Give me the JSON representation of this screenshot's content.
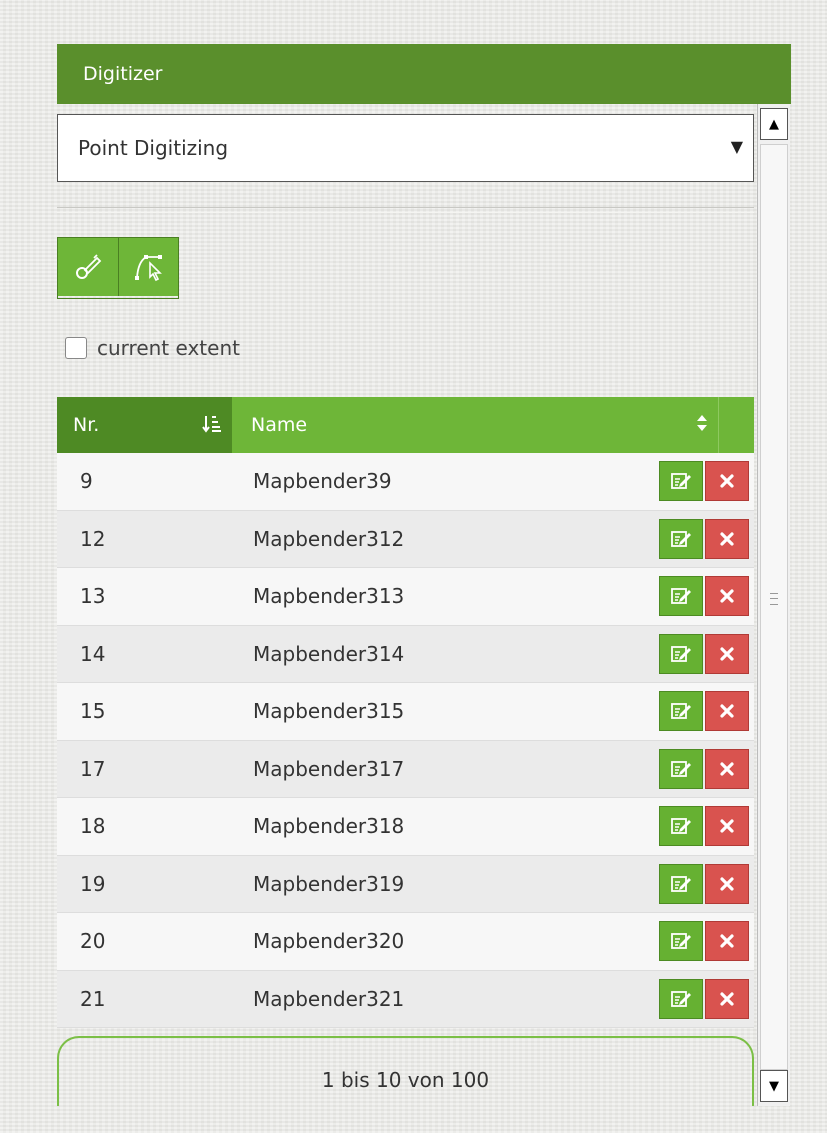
{
  "panel": {
    "title": "Digitizer"
  },
  "schema_select": {
    "value": "Point Digitizing"
  },
  "toolbar": {
    "tools": [
      {
        "icon": "draw-point-icon"
      },
      {
        "icon": "modify-feature-icon"
      }
    ]
  },
  "filter": {
    "current_extent_label": "current extent",
    "checked": false
  },
  "table": {
    "columns": [
      "Nr.",
      "Name",
      ""
    ],
    "sort": {
      "column": "Nr.",
      "direction": "ascending"
    },
    "rows": [
      {
        "nr": "9",
        "name": "Mapbender39"
      },
      {
        "nr": "12",
        "name": "Mapbender312"
      },
      {
        "nr": "13",
        "name": "Mapbender313"
      },
      {
        "nr": "14",
        "name": "Mapbender314"
      },
      {
        "nr": "15",
        "name": "Mapbender315"
      },
      {
        "nr": "17",
        "name": "Mapbender317"
      },
      {
        "nr": "18",
        "name": "Mapbender318"
      },
      {
        "nr": "19",
        "name": "Mapbender319"
      },
      {
        "nr": "20",
        "name": "Mapbender320"
      },
      {
        "nr": "21",
        "name": "Mapbender321"
      }
    ]
  },
  "pagination": {
    "info": "1 bis 10 von 100"
  },
  "colors": {
    "header_green": "#5a8f2c",
    "table_header": "#6eb638",
    "edit_button": "#66b132",
    "delete_button": "#d9534f"
  }
}
